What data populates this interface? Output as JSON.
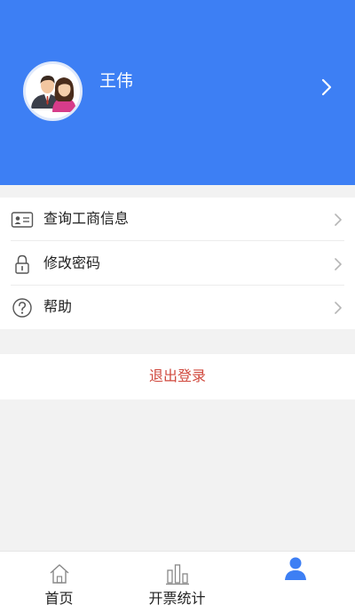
{
  "profile": {
    "name": "王伟"
  },
  "menu": {
    "items": [
      {
        "label": "查询工商信息",
        "icon": "id-card-icon"
      },
      {
        "label": "修改密码",
        "icon": "lock-icon"
      },
      {
        "label": "帮助",
        "icon": "help-icon"
      }
    ]
  },
  "logout": {
    "label": "退出登录"
  },
  "tabbar": {
    "items": [
      {
        "label": "首页",
        "icon": "home-icon"
      },
      {
        "label": "开票统计",
        "icon": "bar-chart-icon"
      },
      {
        "label": "",
        "icon": "user-icon",
        "active": true
      }
    ]
  },
  "colors": {
    "header_bg": "#3d7ff4",
    "logout_text": "#d0493e",
    "active_tab": "#3d7ff4",
    "background": "#f2f2f2"
  }
}
